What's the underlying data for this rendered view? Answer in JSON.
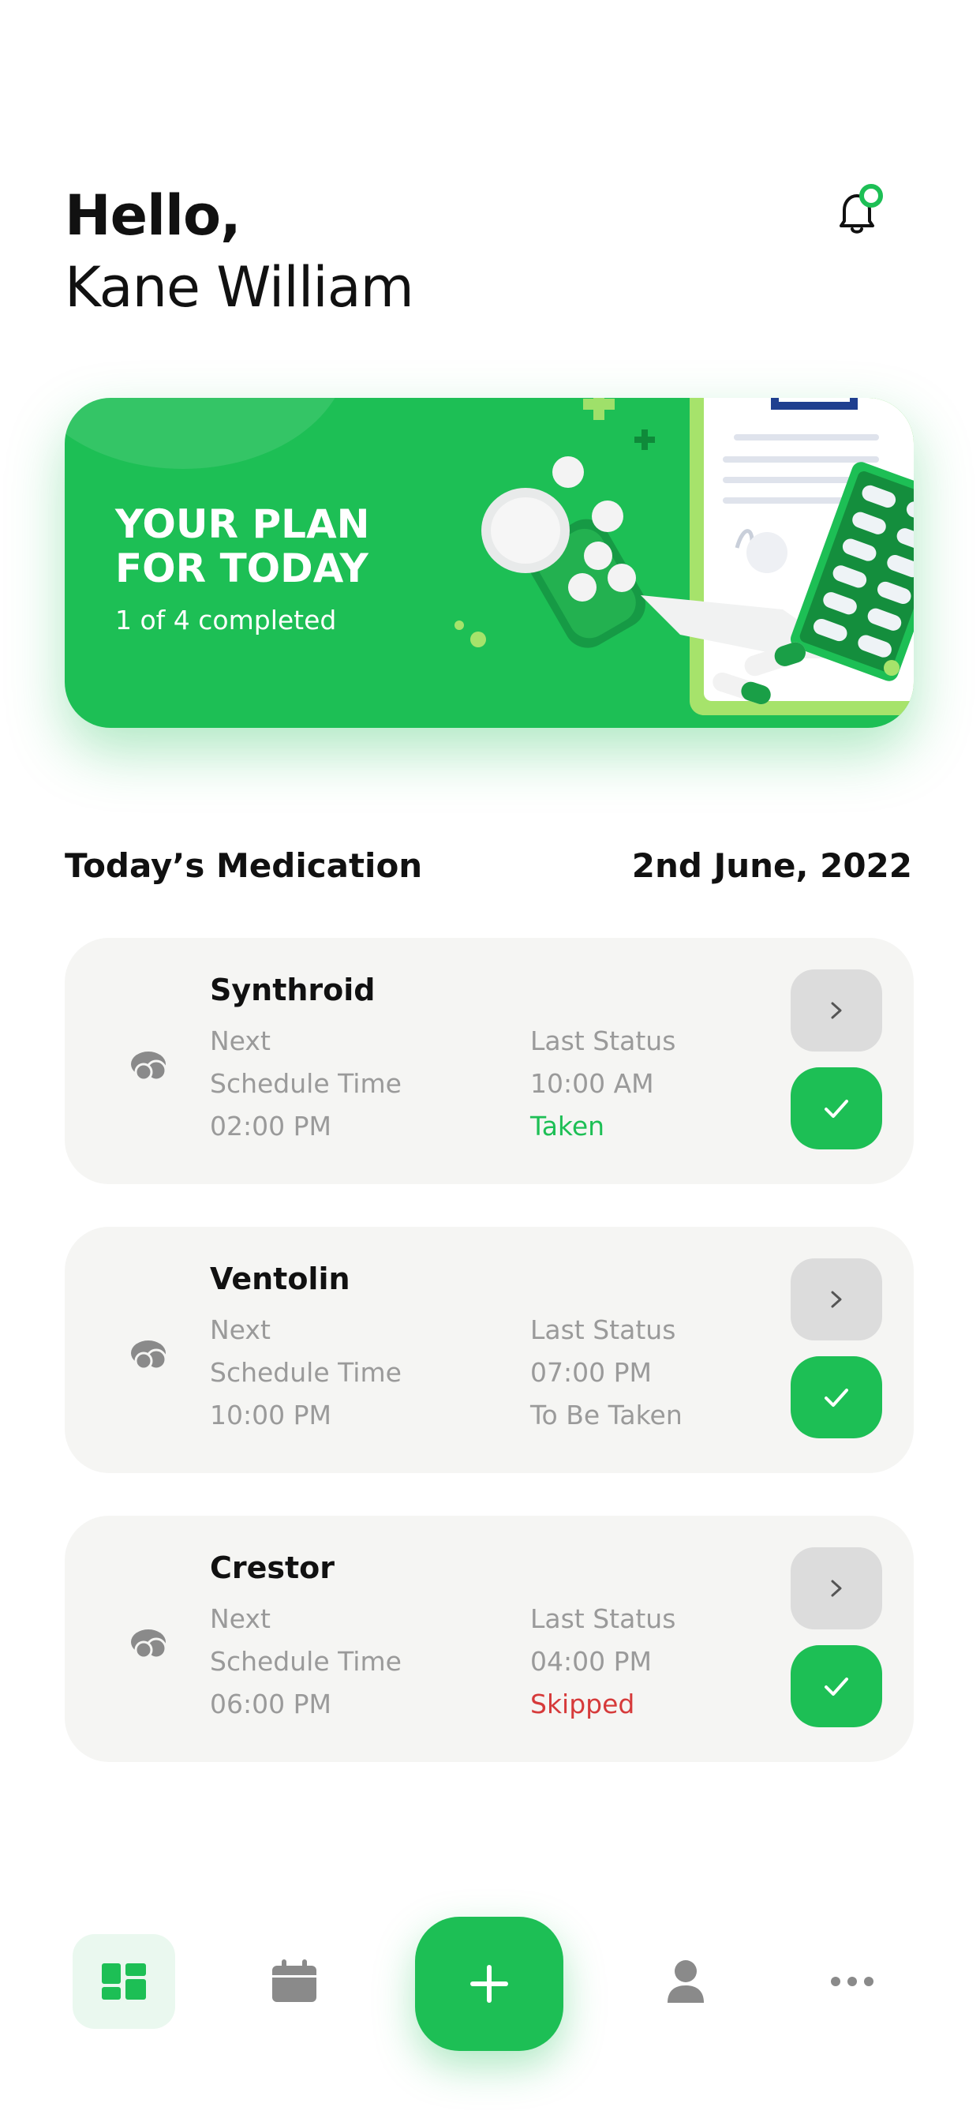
{
  "header": {
    "greeting": "Hello,",
    "user_name": "Kane William",
    "notification_icon": "bell-icon"
  },
  "banner": {
    "title_line1": "YOUR PLAN",
    "title_line2": "FOR TODAY",
    "progress_text": "1 of 4 completed"
  },
  "section": {
    "title": "Today’s Medication",
    "date": "2nd June, 2022"
  },
  "medications": [
    {
      "name": "Synthroid",
      "next_label": "Next",
      "schedule_label": "Schedule Time",
      "schedule_time": "02:00 PM",
      "last_status_label": "Last Status",
      "last_time": "10:00 AM",
      "status": "Taken"
    },
    {
      "name": "Ventolin",
      "next_label": "Next",
      "schedule_label": "Schedule Time",
      "schedule_time": "10:00 PM",
      "last_status_label": "Last Status",
      "last_time": "07:00 PM",
      "status": "To Be Taken"
    },
    {
      "name": "Crestor",
      "next_label": "Next",
      "schedule_label": "Schedule Time",
      "schedule_time": "06:00 PM",
      "last_status_label": "Last Status",
      "last_time": "04:00 PM",
      "status": "Skipped"
    }
  ],
  "bottom_nav": {
    "items": [
      "dashboard-icon",
      "calendar-icon",
      "plus-icon",
      "user-icon",
      "more-icon"
    ]
  },
  "colors": {
    "accent": "#1dbf55",
    "card_bg": "#f5f5f3",
    "skipped": "#d63a3a",
    "muted_text": "#9a9a9a"
  }
}
